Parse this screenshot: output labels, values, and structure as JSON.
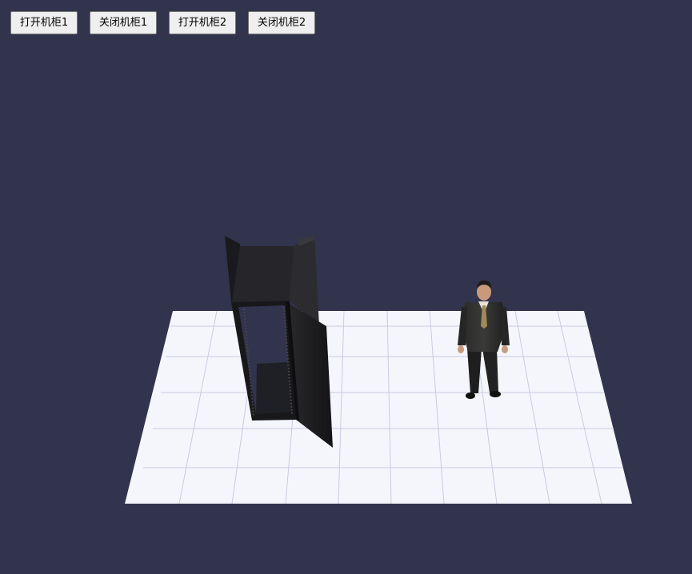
{
  "toolbar": {
    "buttons": [
      {
        "label": "打开机柜1"
      },
      {
        "label": "关闭机柜1"
      },
      {
        "label": "打开机柜2"
      },
      {
        "label": "关闭机柜2"
      }
    ]
  },
  "colors": {
    "background": "#32334d",
    "floor": "#f5f6fc",
    "grid": "#c9cbe0",
    "cabinet": "#1c1c20"
  }
}
